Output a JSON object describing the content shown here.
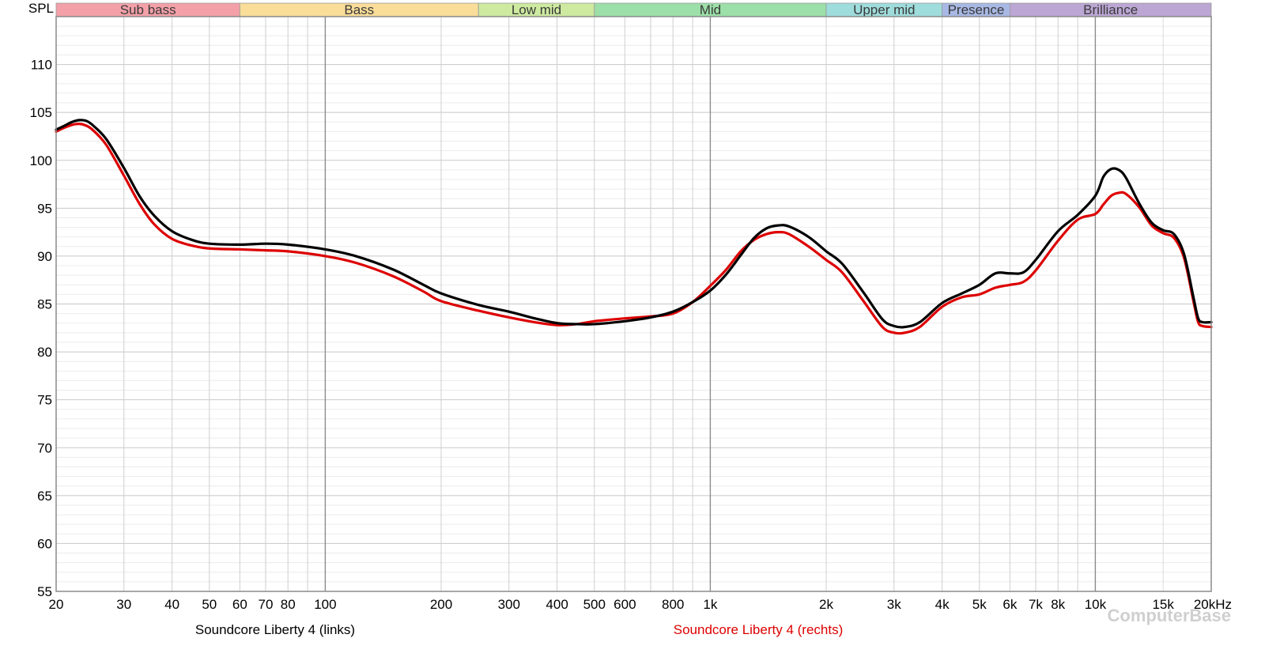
{
  "chart_data": {
    "type": "line",
    "x_scale": "log",
    "xlim": [
      20,
      20000
    ],
    "ylim": [
      55,
      115
    ],
    "grid": true,
    "ylabel": "SPL",
    "xlabel": "",
    "y_ticks": [
      55,
      60,
      65,
      70,
      75,
      80,
      85,
      90,
      95,
      100,
      105,
      110
    ],
    "x_ticks": [
      {
        "value": 20,
        "label": "20"
      },
      {
        "value": 30,
        "label": "30"
      },
      {
        "value": 40,
        "label": "40"
      },
      {
        "value": 50,
        "label": "50"
      },
      {
        "value": 60,
        "label": "60"
      },
      {
        "value": 70,
        "label": "70"
      },
      {
        "value": 80,
        "label": "80"
      },
      {
        "value": 100,
        "label": "100"
      },
      {
        "value": 200,
        "label": "200"
      },
      {
        "value": 300,
        "label": "300"
      },
      {
        "value": 400,
        "label": "400"
      },
      {
        "value": 500,
        "label": "500"
      },
      {
        "value": 600,
        "label": "600"
      },
      {
        "value": 800,
        "label": "800"
      },
      {
        "value": 1000,
        "label": "1k"
      },
      {
        "value": 2000,
        "label": "2k"
      },
      {
        "value": 3000,
        "label": "3k"
      },
      {
        "value": 4000,
        "label": "4k"
      },
      {
        "value": 5000,
        "label": "5k"
      },
      {
        "value": 6000,
        "label": "6k"
      },
      {
        "value": 7000,
        "label": "7k"
      },
      {
        "value": 8000,
        "label": "8k"
      },
      {
        "value": 10000,
        "label": "10k"
      },
      {
        "value": 15000,
        "label": "15k"
      },
      {
        "value": 20000,
        "label": "20kHz"
      }
    ],
    "bands": [
      {
        "name": "Sub bass",
        "from": 20,
        "to": 60,
        "color": "#f4a0a8"
      },
      {
        "name": "Bass",
        "from": 60,
        "to": 250,
        "color": "#f9dd98"
      },
      {
        "name": "Low mid",
        "from": 250,
        "to": 500,
        "color": "#cdeaa0"
      },
      {
        "name": "Mid",
        "from": 500,
        "to": 2000,
        "color": "#9cdfa8"
      },
      {
        "name": "Upper mid",
        "from": 2000,
        "to": 4000,
        "color": "#9fdcdc"
      },
      {
        "name": "Presence",
        "from": 4000,
        "to": 6000,
        "color": "#a8b8e4"
      },
      {
        "name": "Brilliance",
        "from": 6000,
        "to": 20000,
        "color": "#bba6d4"
      }
    ],
    "series": [
      {
        "name": "Soundcore Liberty 4 (links)",
        "color": "#000000",
        "points": [
          [
            20,
            103.2
          ],
          [
            21,
            103.6
          ],
          [
            22,
            104.0
          ],
          [
            23,
            104.2
          ],
          [
            24,
            104.1
          ],
          [
            25,
            103.6
          ],
          [
            27,
            102.2
          ],
          [
            30,
            99.2
          ],
          [
            33,
            96.2
          ],
          [
            36,
            94.2
          ],
          [
            40,
            92.6
          ],
          [
            45,
            91.7
          ],
          [
            50,
            91.3
          ],
          [
            60,
            91.2
          ],
          [
            70,
            91.3
          ],
          [
            80,
            91.2
          ],
          [
            100,
            90.7
          ],
          [
            120,
            90.0
          ],
          [
            150,
            88.6
          ],
          [
            180,
            87.0
          ],
          [
            200,
            86.1
          ],
          [
            250,
            84.9
          ],
          [
            300,
            84.2
          ],
          [
            350,
            83.5
          ],
          [
            400,
            83.0
          ],
          [
            450,
            82.9
          ],
          [
            500,
            82.9
          ],
          [
            600,
            83.2
          ],
          [
            700,
            83.6
          ],
          [
            800,
            84.2
          ],
          [
            900,
            85.2
          ],
          [
            1000,
            86.4
          ],
          [
            1100,
            88.1
          ],
          [
            1200,
            90.1
          ],
          [
            1300,
            91.9
          ],
          [
            1400,
            92.9
          ],
          [
            1500,
            93.2
          ],
          [
            1600,
            93.1
          ],
          [
            1800,
            92.0
          ],
          [
            2000,
            90.5
          ],
          [
            2200,
            89.2
          ],
          [
            2500,
            86.2
          ],
          [
            2800,
            83.4
          ],
          [
            3000,
            82.7
          ],
          [
            3200,
            82.6
          ],
          [
            3500,
            83.1
          ],
          [
            4000,
            85.1
          ],
          [
            4500,
            86.1
          ],
          [
            5000,
            87.0
          ],
          [
            5500,
            88.2
          ],
          [
            6000,
            88.2
          ],
          [
            6500,
            88.3
          ],
          [
            7000,
            89.6
          ],
          [
            8000,
            92.6
          ],
          [
            9000,
            94.3
          ],
          [
            10000,
            96.3
          ],
          [
            10500,
            98.3
          ],
          [
            11000,
            99.1
          ],
          [
            11500,
            99.0
          ],
          [
            12000,
            98.2
          ],
          [
            13000,
            95.5
          ],
          [
            14000,
            93.5
          ],
          [
            15000,
            92.7
          ],
          [
            16000,
            92.3
          ],
          [
            17000,
            90.2
          ],
          [
            18000,
            85.6
          ],
          [
            18500,
            83.5
          ],
          [
            19000,
            83.1
          ],
          [
            20000,
            83.1
          ]
        ]
      },
      {
        "name": "Soundcore Liberty 4 (rechts)",
        "color": "#dd0000",
        "points": [
          [
            20,
            103.0
          ],
          [
            21,
            103.4
          ],
          [
            22,
            103.7
          ],
          [
            23,
            103.8
          ],
          [
            24,
            103.6
          ],
          [
            25,
            103.1
          ],
          [
            27,
            101.6
          ],
          [
            30,
            98.4
          ],
          [
            33,
            95.4
          ],
          [
            36,
            93.3
          ],
          [
            40,
            91.8
          ],
          [
            45,
            91.1
          ],
          [
            50,
            90.8
          ],
          [
            60,
            90.7
          ],
          [
            70,
            90.6
          ],
          [
            80,
            90.5
          ],
          [
            100,
            90.0
          ],
          [
            120,
            89.3
          ],
          [
            150,
            87.9
          ],
          [
            180,
            86.3
          ],
          [
            200,
            85.3
          ],
          [
            250,
            84.3
          ],
          [
            300,
            83.6
          ],
          [
            350,
            83.1
          ],
          [
            400,
            82.8
          ],
          [
            450,
            82.9
          ],
          [
            500,
            83.2
          ],
          [
            600,
            83.5
          ],
          [
            700,
            83.7
          ],
          [
            800,
            84.0
          ],
          [
            900,
            85.2
          ],
          [
            1000,
            86.9
          ],
          [
            1100,
            88.6
          ],
          [
            1200,
            90.5
          ],
          [
            1300,
            91.7
          ],
          [
            1400,
            92.3
          ],
          [
            1500,
            92.5
          ],
          [
            1600,
            92.3
          ],
          [
            1800,
            91.0
          ],
          [
            2000,
            89.6
          ],
          [
            2200,
            88.3
          ],
          [
            2500,
            85.3
          ],
          [
            2800,
            82.6
          ],
          [
            3000,
            82.0
          ],
          [
            3200,
            82.0
          ],
          [
            3500,
            82.6
          ],
          [
            4000,
            84.7
          ],
          [
            4500,
            85.7
          ],
          [
            5000,
            86.0
          ],
          [
            5500,
            86.7
          ],
          [
            6000,
            87.0
          ],
          [
            6500,
            87.3
          ],
          [
            7000,
            88.5
          ],
          [
            8000,
            91.6
          ],
          [
            9000,
            93.8
          ],
          [
            10000,
            94.4
          ],
          [
            10500,
            95.4
          ],
          [
            11000,
            96.3
          ],
          [
            11500,
            96.6
          ],
          [
            12000,
            96.5
          ],
          [
            13000,
            95.1
          ],
          [
            14000,
            93.2
          ],
          [
            15000,
            92.4
          ],
          [
            16000,
            91.9
          ],
          [
            17000,
            89.8
          ],
          [
            18000,
            85.2
          ],
          [
            18500,
            83.1
          ],
          [
            19000,
            82.7
          ],
          [
            20000,
            82.6
          ]
        ]
      }
    ],
    "legend": [
      "Soundcore Liberty 4 (links)",
      "Soundcore Liberty 4 (rechts)"
    ]
  },
  "watermark": "ComputerBase"
}
